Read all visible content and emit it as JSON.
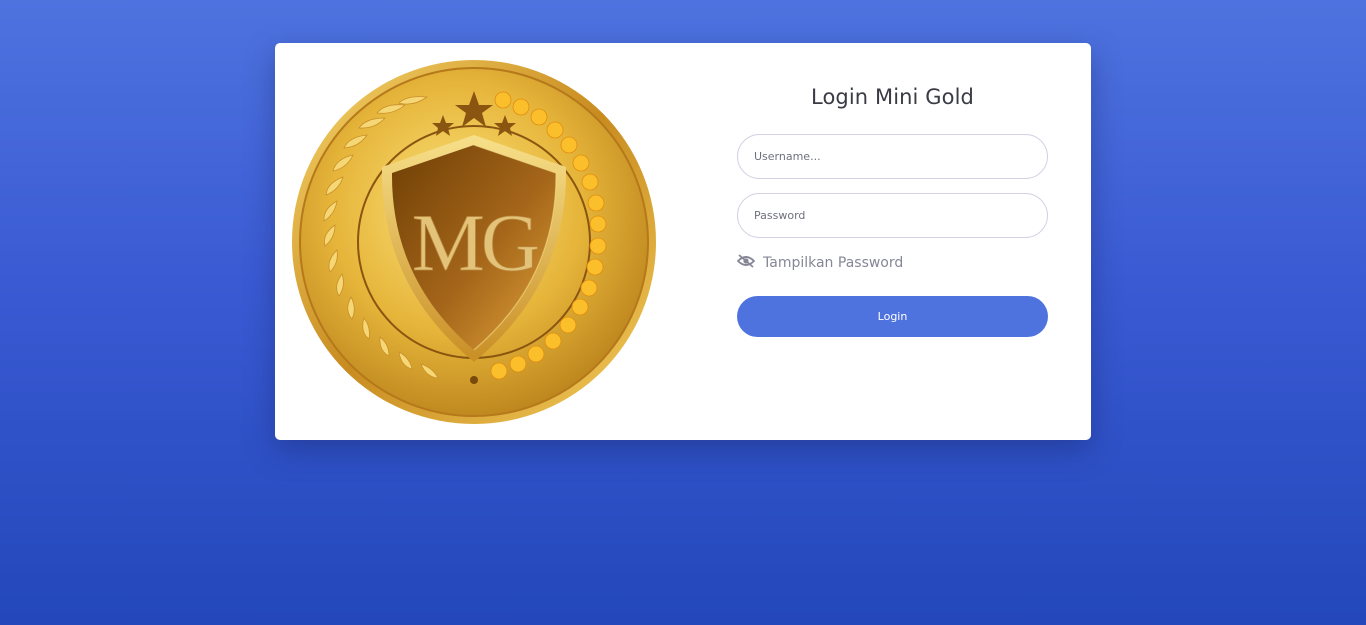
{
  "login": {
    "title": "Login Mini Gold",
    "username_placeholder": "Username...",
    "password_placeholder": "Password",
    "show_password_label": "Tampilkan Password",
    "show_password_icon": "eye-slash-icon",
    "submit_label": "Login"
  },
  "logo": {
    "text": "MG"
  },
  "colors": {
    "background_top": "#4e73df",
    "background_bottom": "#2348bb",
    "primary": "#4e73df",
    "gold": "#d9a62a"
  }
}
